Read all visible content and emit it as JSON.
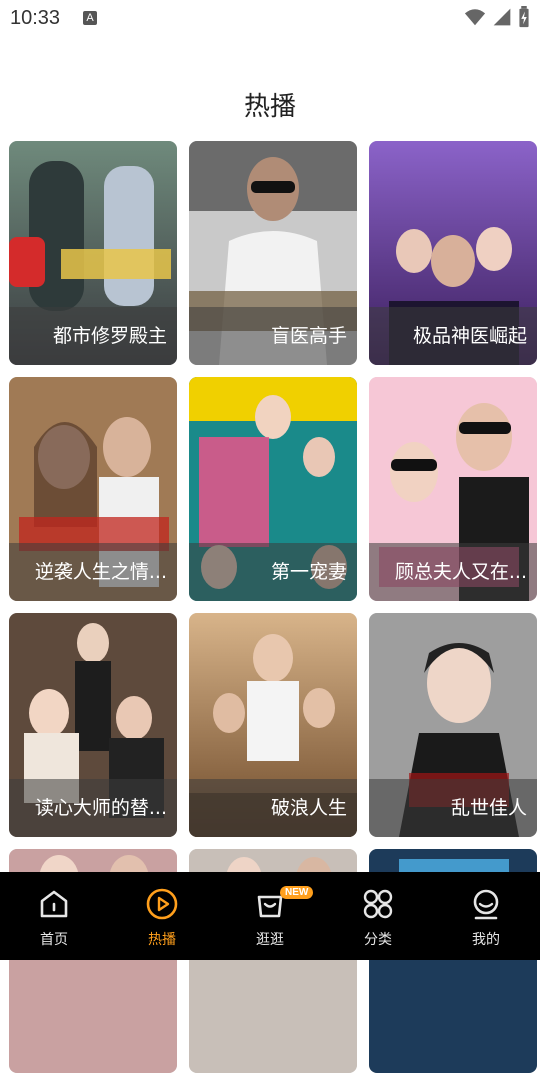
{
  "status_bar": {
    "time": "10:33",
    "notification_icon": "A"
  },
  "page_title": "热播",
  "dramas": [
    {
      "title": "都市修罗殿主"
    },
    {
      "title": "盲医高手"
    },
    {
      "title": "极品神医崛起"
    },
    {
      "title": "逆袭人生之情..."
    },
    {
      "title": "第一宠妻"
    },
    {
      "title": "顾总夫人又在..."
    },
    {
      "title": "读心大师的替..."
    },
    {
      "title": "破浪人生"
    },
    {
      "title": "乱世佳人"
    }
  ],
  "bottom_nav": {
    "items": [
      {
        "label": "首页",
        "icon": "home-icon",
        "active": false
      },
      {
        "label": "热播",
        "icon": "play-circle-icon",
        "active": true
      },
      {
        "label": "逛逛",
        "icon": "shopping-bag-icon",
        "active": false,
        "badge": "NEW"
      },
      {
        "label": "分类",
        "icon": "grid-icon",
        "active": false
      },
      {
        "label": "我的",
        "icon": "profile-icon",
        "active": false
      }
    ]
  },
  "colors": {
    "accent": "#ff9f1c",
    "nav_background": "#000000"
  }
}
